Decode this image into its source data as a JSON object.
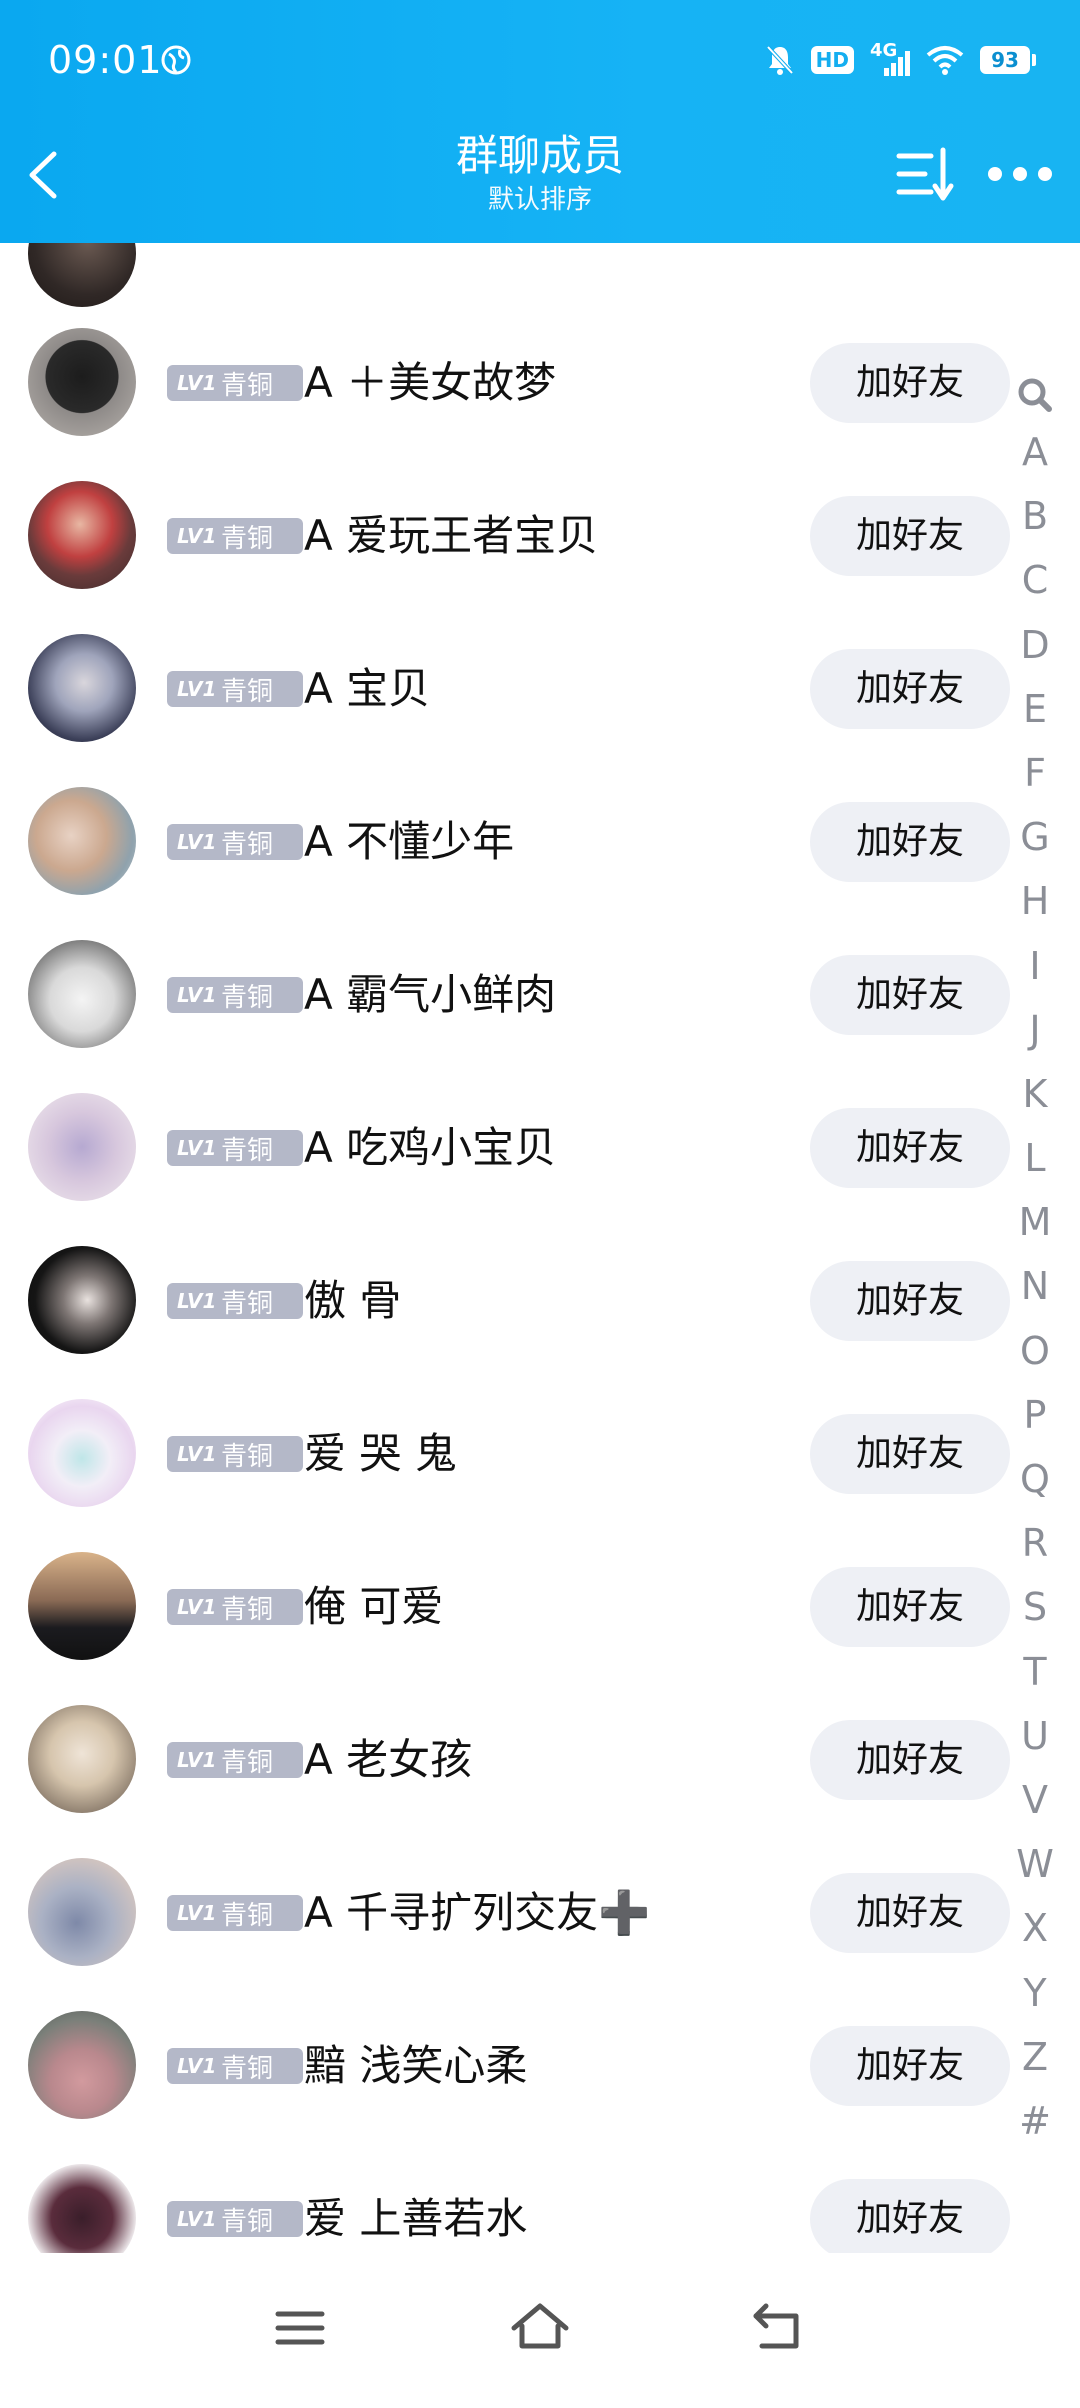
{
  "status_bar": {
    "time": "09:01",
    "hd": "HD",
    "network": "4G",
    "battery": "93"
  },
  "header": {
    "title": "群聊成员",
    "subtitle": "默认排序",
    "back_icon": "chevron-left-icon",
    "sort_icon": "sort-icon",
    "more_icon": "more-dots-icon"
  },
  "members": [
    {
      "level": "LV1",
      "tier": "青铜",
      "name": "A ＋美女故梦",
      "action": "加好友"
    },
    {
      "level": "LV1",
      "tier": "青铜",
      "name": "A 爱玩王者宝贝",
      "action": "加好友"
    },
    {
      "level": "LV1",
      "tier": "青铜",
      "name": "A 宝贝",
      "action": "加好友"
    },
    {
      "level": "LV1",
      "tier": "青铜",
      "name": "A 不懂少年",
      "action": "加好友"
    },
    {
      "level": "LV1",
      "tier": "青铜",
      "name": "A 霸气小鲜肉",
      "action": "加好友"
    },
    {
      "level": "LV1",
      "tier": "青铜",
      "name": "A 吃鸡小宝贝",
      "action": "加好友"
    },
    {
      "level": "LV1",
      "tier": "青铜",
      "name": "傲 骨",
      "action": "加好友"
    },
    {
      "level": "LV1",
      "tier": "青铜",
      "name": "爱 哭 鬼",
      "action": "加好友"
    },
    {
      "level": "LV1",
      "tier": "青铜",
      "name": "俺 可爱",
      "action": "加好友"
    },
    {
      "level": "LV1",
      "tier": "青铜",
      "name": "A 老女孩",
      "action": "加好友"
    },
    {
      "level": "LV1",
      "tier": "青铜",
      "name": "A 千寻扩列交友➕",
      "action": "加好友"
    },
    {
      "level": "LV1",
      "tier": "青铜",
      "name": "黯 浅笑心柔",
      "action": "加好友"
    },
    {
      "level": "LV1",
      "tier": "青铜",
      "name": "爱 上善若水",
      "action": "加好友"
    }
  ],
  "index_bar": {
    "search_icon": "search-icon",
    "letters": [
      "A",
      "B",
      "C",
      "D",
      "E",
      "F",
      "G",
      "H",
      "I",
      "J",
      "K",
      "L",
      "M",
      "N",
      "O",
      "P",
      "Q",
      "R",
      "S",
      "T",
      "U",
      "V",
      "W",
      "X",
      "Y",
      "Z",
      "#"
    ]
  },
  "navbar": {
    "menu_icon": "menu-icon",
    "home_icon": "home-icon",
    "back_icon": "back-icon"
  },
  "colors": {
    "header": "#14aef0",
    "level_badge": "#b4b8c8",
    "button_bg": "#eef0f5",
    "index_text": "#8b8e96"
  }
}
